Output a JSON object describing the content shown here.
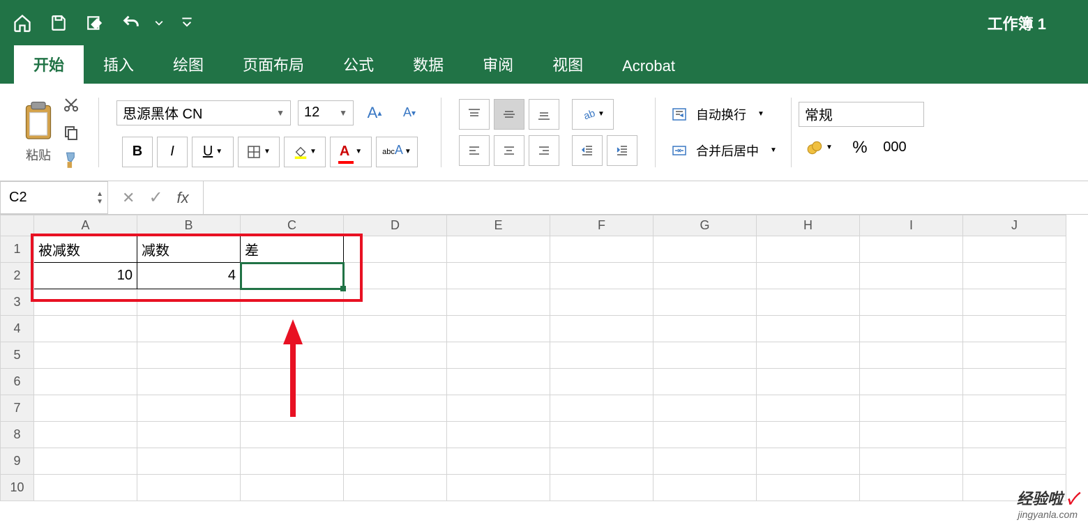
{
  "doc_title": "工作簿 1",
  "tabs": [
    "开始",
    "插入",
    "绘图",
    "页面布局",
    "公式",
    "数据",
    "审阅",
    "视图",
    "Acrobat"
  ],
  "ribbon": {
    "paste_label": "粘贴",
    "font_name": "思源黑体 CN",
    "font_size": "12",
    "wrap_text": "自动换行",
    "merge_center": "合并后居中",
    "number_format": "常规"
  },
  "formula_bar": {
    "name_box": "C2",
    "fx": "fx",
    "value": ""
  },
  "columns": [
    "A",
    "B",
    "C",
    "D",
    "E",
    "F",
    "G",
    "H",
    "I",
    "J"
  ],
  "rows": [
    "1",
    "2",
    "3",
    "4",
    "5",
    "6",
    "7",
    "8",
    "9",
    "10"
  ],
  "cells": {
    "A1": "被减数",
    "B1": "减数",
    "C1": "差",
    "A2": "10",
    "B2": "4"
  },
  "watermark": {
    "line1": "经验啦",
    "check": "✓",
    "line2": "jingyanla.com"
  }
}
